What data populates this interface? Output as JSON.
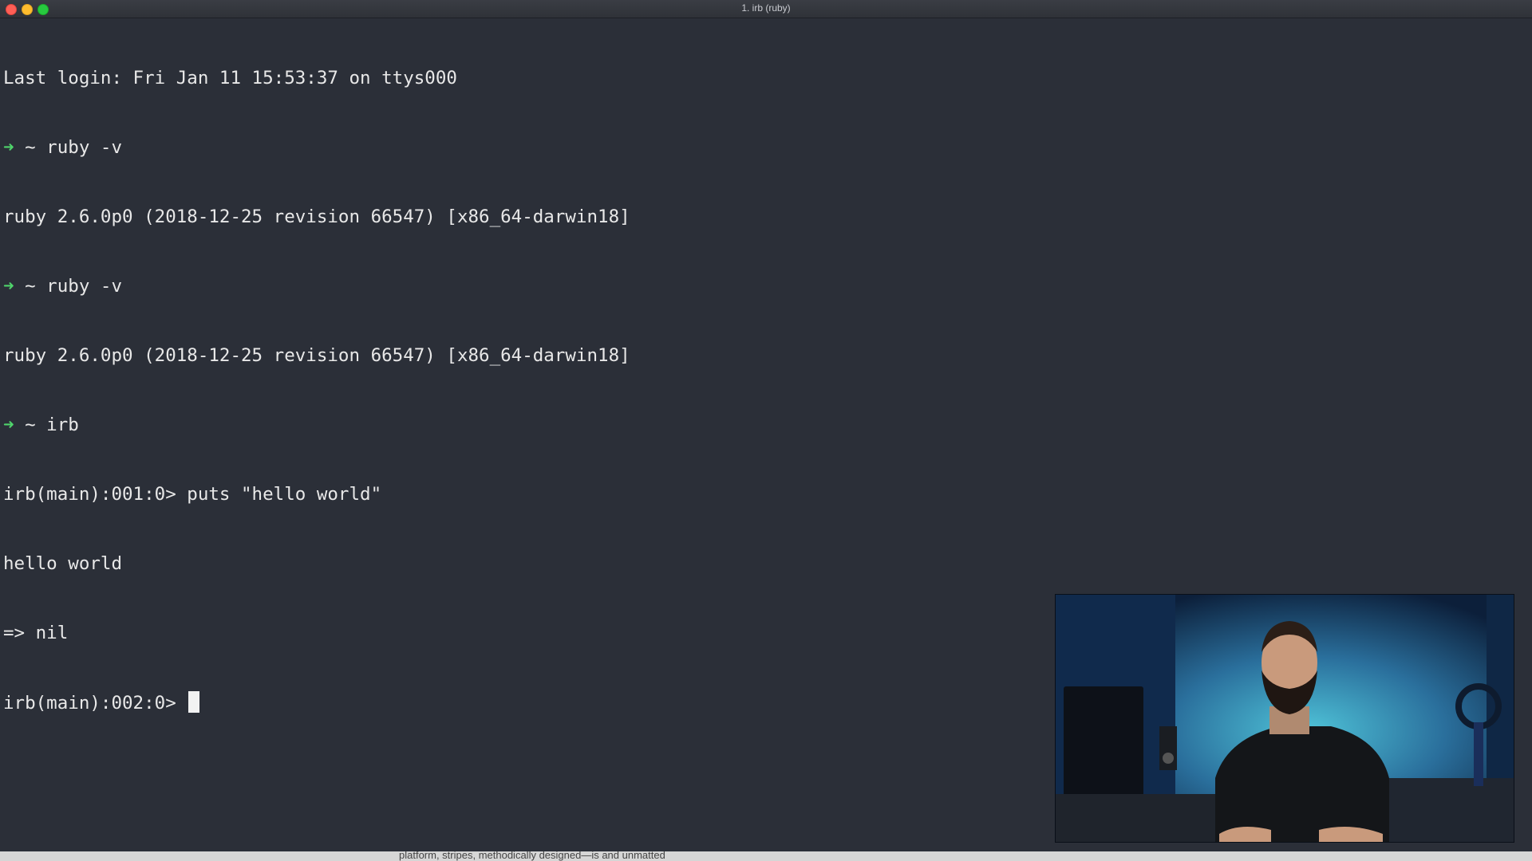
{
  "window": {
    "title": "1. irb (ruby)"
  },
  "terminal": {
    "lines": [
      {
        "prompt": "",
        "text": "Last login: Fri Jan 11 15:53:37 on ttys000"
      },
      {
        "prompt": "➜",
        "text": " ~ ruby -v"
      },
      {
        "prompt": "",
        "text": "ruby 2.6.0p0 (2018-12-25 revision 66547) [x86_64-darwin18]"
      },
      {
        "prompt": "➜",
        "text": " ~ ruby -v"
      },
      {
        "prompt": "",
        "text": "ruby 2.6.0p0 (2018-12-25 revision 66547) [x86_64-darwin18]"
      },
      {
        "prompt": "➜",
        "text": " ~ irb"
      },
      {
        "prompt": "",
        "text": "irb(main):001:0> puts \"hello world\""
      },
      {
        "prompt": "",
        "text": "hello world"
      },
      {
        "prompt": "",
        "text": "=> nil"
      },
      {
        "prompt": "",
        "text": "irb(main):002:0> "
      }
    ]
  },
  "bottom_bar": {
    "text": "platform, stripes, methodically designed—is and unmatted"
  },
  "colors": {
    "background": "#2b2f38",
    "foreground": "#e8e8e8",
    "prompt_arrow": "#4fd46b"
  },
  "icons": {
    "close": "close-icon",
    "minimize": "minimize-icon",
    "maximize": "maximize-icon"
  }
}
